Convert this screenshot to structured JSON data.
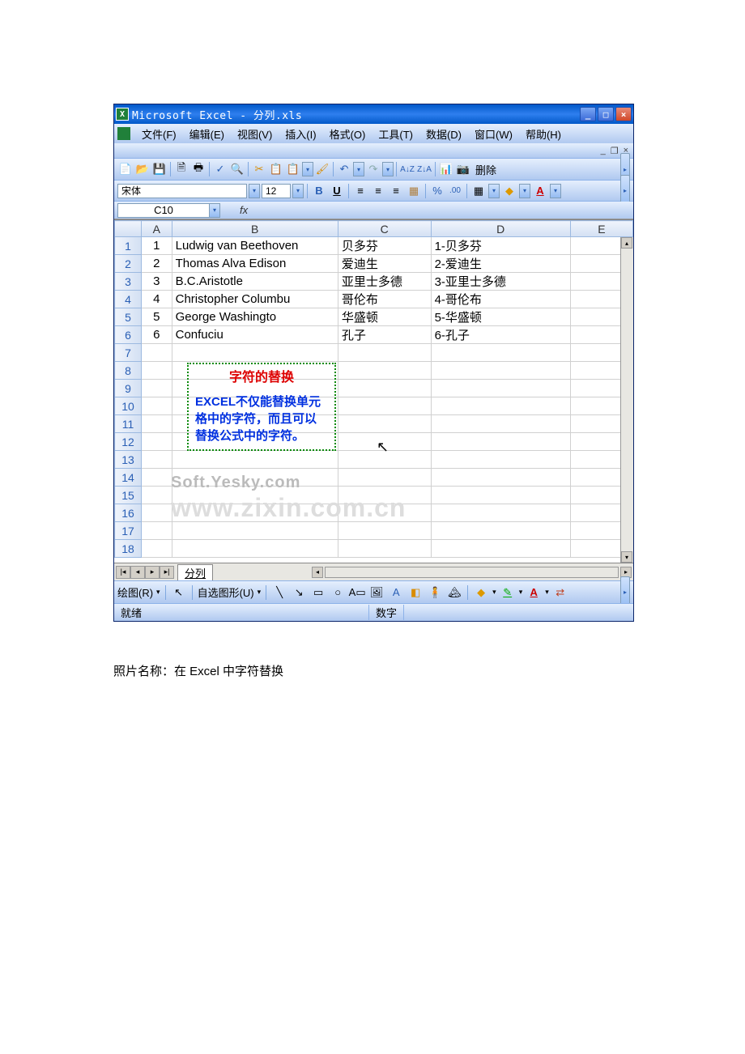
{
  "title": "Microsoft Excel - 分列.xls",
  "menu": {
    "file": "文件(F)",
    "edit": "编辑(E)",
    "view": "视图(V)",
    "insert": "插入(I)",
    "format": "格式(O)",
    "tools": "工具(T)",
    "data": "数据(D)",
    "window": "窗口(W)",
    "help": "帮助(H)"
  },
  "toolbar": {
    "delete": "删除"
  },
  "format": {
    "font": "宋体",
    "size": "12"
  },
  "namebox": "C10",
  "fx": "fx",
  "cols": [
    "A",
    "B",
    "C",
    "D",
    "E"
  ],
  "rows": [
    {
      "n": "1",
      "a": "1",
      "b": "Ludwig van Beethoven",
      "c": "贝多芬",
      "d": "1-贝多芬"
    },
    {
      "n": "2",
      "a": "2",
      "b": "Thomas Alva Edison",
      "c": "爱迪生",
      "d": "2-爱迪生"
    },
    {
      "n": "3",
      "a": "3",
      "b": "B.C.Aristotle",
      "c": "亚里士多德",
      "d": "3-亚里士多德"
    },
    {
      "n": "4",
      "a": "4",
      "b": "Christopher Columbu",
      "c": "哥伦布",
      "d": "4-哥伦布"
    },
    {
      "n": "5",
      "a": "5",
      "b": "George Washingto",
      "c": "华盛顿",
      "d": "5-华盛顿"
    },
    {
      "n": "6",
      "a": "6",
      "b": "Confuciu",
      "c": "孔子",
      "d": "6-孔子"
    }
  ],
  "empty_rows": [
    "7",
    "8",
    "9",
    "10",
    "11",
    "12",
    "13",
    "14",
    "15",
    "16",
    "17",
    "18"
  ],
  "annotation": {
    "title": "字符的替换",
    "body1": "EXCEL不仅能替换单元格中的字符，而且可以替换公式中的字符。"
  },
  "watermark": "Soft.Yesky.com",
  "watermark2": "www.zixin.com.cn",
  "sheet": "分列",
  "drawbar": {
    "draw": "绘图(R)",
    "shapes": "自选图形(U)"
  },
  "status": {
    "ready": "就绪",
    "num": "数字"
  },
  "caption": "照片名称：在 Excel 中字符替换"
}
